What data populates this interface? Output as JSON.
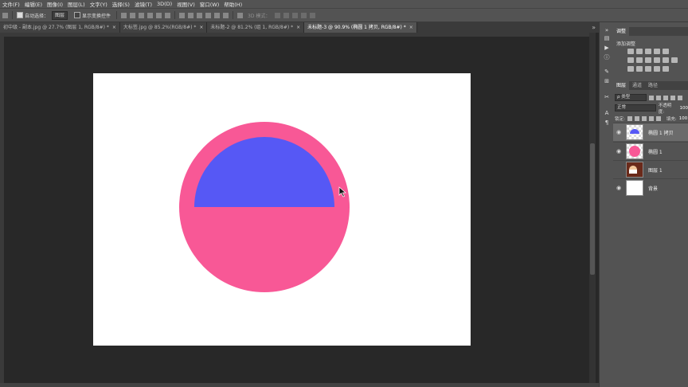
{
  "menu": [
    "文件(F)",
    "编辑(E)",
    "图像(I)",
    "图层(L)",
    "文字(Y)",
    "选择(S)",
    "滤镜(T)",
    "3D(D)",
    "视图(V)",
    "窗口(W)",
    "帮助(H)"
  ],
  "options": {
    "auto_select_label": "自动选择：",
    "auto_select_value": "图层",
    "show_transform_label": "显示变换控件",
    "mode_3d_label": "3D 模式："
  },
  "tabs": [
    {
      "label": "初中级 - 副本.jpg @ 27.7% (图层 1, RGB/8#) *",
      "active": false
    },
    {
      "label": "大标签.jpg @ 85.2%(RGB/8#) *",
      "active": false
    },
    {
      "label": "未标题-2 @ 81.2% (组 1, RGB/8#) *",
      "active": false
    },
    {
      "label": "未标题-3 @ 90.9% (椭圆 1 拷贝, RGB/8#) *",
      "active": true
    }
  ],
  "tab_close": "×",
  "tab_more": "»",
  "panel": {
    "adjust_tab": "调整",
    "adjust_title": "添加调整",
    "layer_tabs": [
      "图层",
      "通道",
      "路径"
    ],
    "filter_kind": "ρ 类型",
    "blend_mode": "正常",
    "opacity_label": "不透明度:",
    "opacity_value": "100",
    "lock_label": "锁定:",
    "fill_label": "填充:",
    "fill_value": "100"
  },
  "layers": [
    {
      "name": "椭圆 1 拷贝",
      "visible": true,
      "selected": true,
      "thumb": "half-purple"
    },
    {
      "name": "椭圆 1",
      "visible": true,
      "selected": false,
      "thumb": "pink-circle"
    },
    {
      "name": "图层 1",
      "visible": false,
      "selected": false,
      "thumb": "photo"
    },
    {
      "name": "背景",
      "visible": true,
      "selected": false,
      "thumb": "white"
    }
  ],
  "colors": {
    "pink": "#F85896",
    "purple": "#5658F5",
    "canvas": "#FFFFFF",
    "workspace": "#282828",
    "panel": "#535353"
  }
}
